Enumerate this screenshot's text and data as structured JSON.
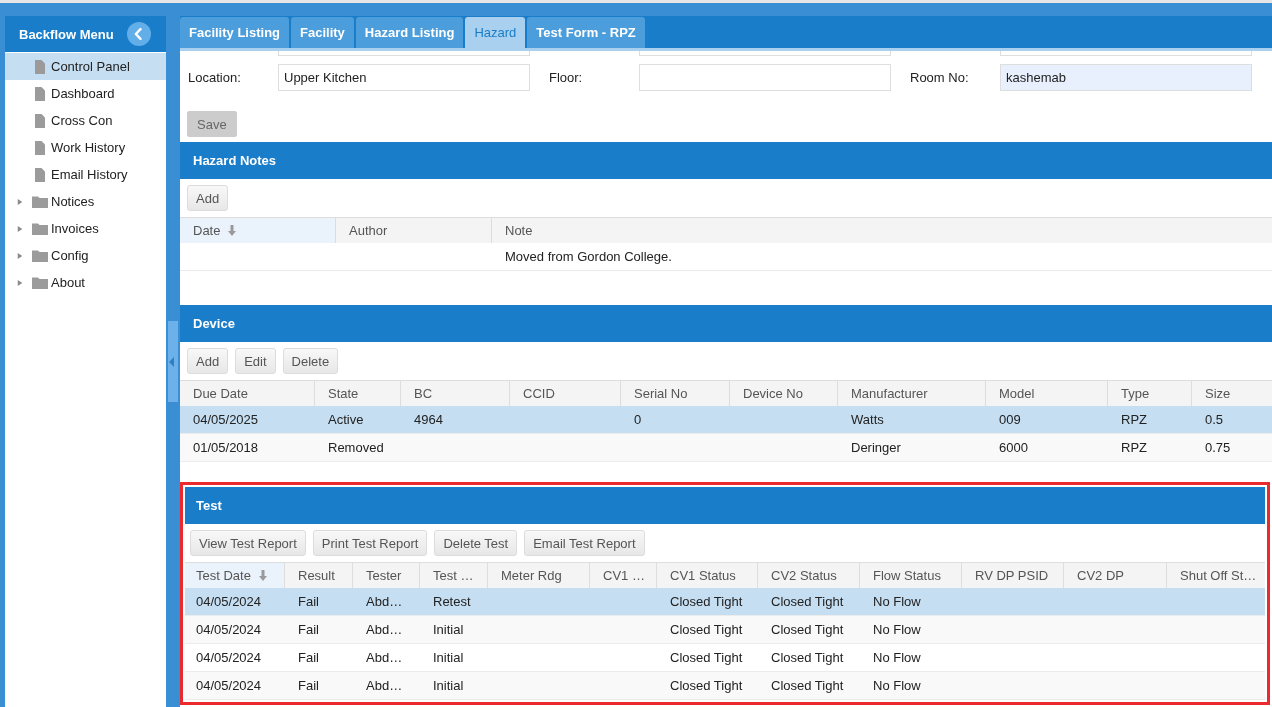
{
  "sidebar": {
    "title": "Backflow Menu",
    "items": [
      {
        "label": "Control Panel",
        "kind": "page",
        "selected": true
      },
      {
        "label": "Dashboard",
        "kind": "page",
        "selected": false
      },
      {
        "label": "Cross Con",
        "kind": "page",
        "selected": false
      },
      {
        "label": "Work History",
        "kind": "page",
        "selected": false
      },
      {
        "label": "Email History",
        "kind": "page",
        "selected": false
      },
      {
        "label": "Notices",
        "kind": "folder",
        "selected": false,
        "expanded": false
      },
      {
        "label": "Invoices",
        "kind": "folder",
        "selected": false,
        "expanded": false
      },
      {
        "label": "Config",
        "kind": "folder",
        "selected": false,
        "expanded": false
      },
      {
        "label": "About",
        "kind": "folder",
        "selected": false,
        "expanded": false
      }
    ]
  },
  "tabs": [
    {
      "label": "Facility Listing",
      "selected": false
    },
    {
      "label": "Facility",
      "selected": false
    },
    {
      "label": "Hazard Listing",
      "selected": false
    },
    {
      "label": "Hazard",
      "selected": true
    },
    {
      "label": "Test Form - RPZ",
      "selected": false
    }
  ],
  "form": {
    "fields": [
      {
        "label": "Location:",
        "value": "Upper Kitchen",
        "autofilled": false
      },
      {
        "label": "Floor:",
        "autofilled": false
      },
      {
        "label": "Room No:",
        "value": "kashemab",
        "autofilled": true
      }
    ],
    "save_button": {
      "label": "Save",
      "disabled": true
    }
  },
  "hazard_notes": {
    "title": "Hazard Notes",
    "buttons": [
      "Add"
    ],
    "columns": [
      {
        "label": "Date",
        "sorted": true
      },
      {
        "label": "Author",
        "sorted": false
      },
      {
        "label": "Note",
        "sorted": false
      }
    ],
    "rows": [
      {
        "selected": false,
        "cells": [
          null,
          null,
          "Moved from Gordon College."
        ]
      }
    ]
  },
  "device": {
    "title": "Device",
    "buttons": [
      "Add",
      "Edit",
      "Delete"
    ],
    "columns": [
      {
        "label": "Due Date",
        "sorted": false
      },
      {
        "label": "State",
        "sorted": false
      },
      {
        "label": "BC",
        "sorted": false
      },
      {
        "label": "CCID",
        "sorted": false
      },
      {
        "label": "Serial No",
        "sorted": false
      },
      {
        "label": "Device No",
        "sorted": false
      },
      {
        "label": "Manufacturer",
        "sorted": false
      },
      {
        "label": "Model",
        "sorted": false
      },
      {
        "label": "Type",
        "sorted": false
      },
      {
        "label": "Size",
        "sorted": false
      }
    ],
    "rows": [
      {
        "selected": true,
        "cells": [
          "04/05/2025",
          "Active",
          "4964",
          null,
          "0",
          null,
          "Watts",
          "009",
          "RPZ",
          "0.5"
        ]
      },
      {
        "selected": false,
        "cells": [
          "01/05/2018",
          "Removed",
          null,
          null,
          null,
          null,
          "Deringer",
          "6000",
          "RPZ",
          "0.75"
        ]
      }
    ]
  },
  "test": {
    "title": "Test",
    "highlighted": true,
    "buttons": [
      "View Test Report",
      "Print Test Report",
      "Delete Test",
      "Email Test Report"
    ],
    "columns": [
      {
        "label": "Test Date",
        "sorted": true
      },
      {
        "label": "Result",
        "sorted": false
      },
      {
        "label": "Tester",
        "sorted": false
      },
      {
        "label": "Test …",
        "sorted": false
      },
      {
        "label": "Meter Rdg",
        "sorted": false
      },
      {
        "label": "CV1 …",
        "sorted": false
      },
      {
        "label": "CV1 Status",
        "sorted": false
      },
      {
        "label": "CV2 Status",
        "sorted": false
      },
      {
        "label": "Flow Status",
        "sorted": false
      },
      {
        "label": "RV DP PSID",
        "sorted": false
      },
      {
        "label": "CV2 DP",
        "sorted": false
      },
      {
        "label": "Shut Off St…",
        "sorted": false
      }
    ],
    "rows": [
      {
        "selected": true,
        "cells": [
          "04/05/2024",
          "Fail",
          "Abd…",
          "Retest",
          null,
          null,
          "Closed Tight",
          "Closed Tight",
          "No Flow",
          null,
          null,
          null
        ]
      },
      {
        "selected": false,
        "cells": [
          "04/05/2024",
          "Fail",
          "Abd…",
          "Initial",
          null,
          null,
          "Closed Tight",
          "Closed Tight",
          "No Flow",
          null,
          null,
          null
        ]
      },
      {
        "selected": false,
        "cells": [
          "04/05/2024",
          "Fail",
          "Abd…",
          "Initial",
          null,
          null,
          "Closed Tight",
          "Closed Tight",
          "No Flow",
          null,
          null,
          null
        ]
      },
      {
        "selected": false,
        "cells": [
          "04/05/2024",
          "Fail",
          "Abd…",
          "Initial",
          null,
          null,
          "Closed Tight",
          "Closed Tight",
          "No Flow",
          null,
          null,
          null
        ]
      }
    ]
  }
}
